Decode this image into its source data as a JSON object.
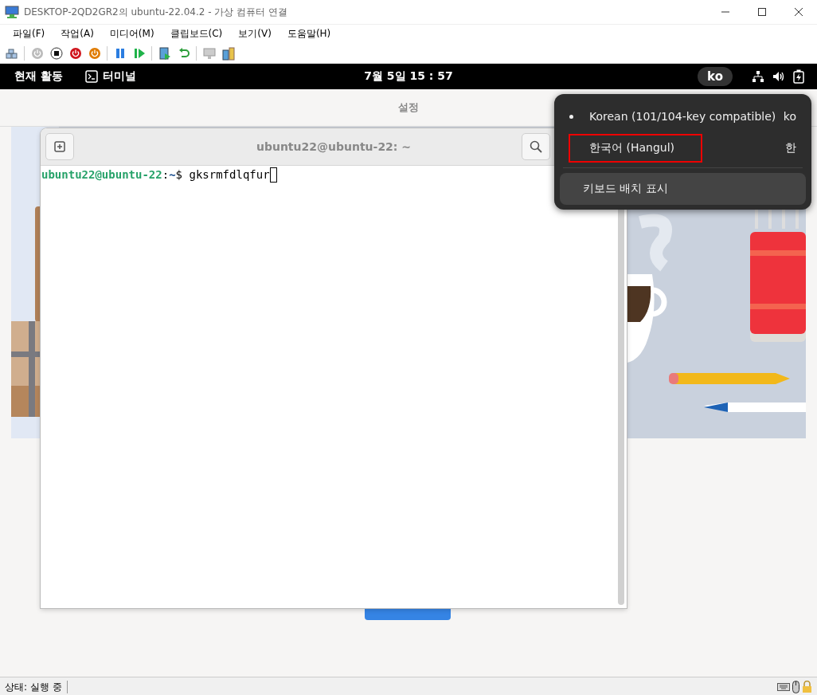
{
  "window": {
    "title": "DESKTOP-2QD2GR2의 ubuntu-22.04.2 - 가상 컴퓨터 연결"
  },
  "menu": [
    "파일(F)",
    "작업(A)",
    "미디어(M)",
    "클립보드(C)",
    "보기(V)",
    "도움말(H)"
  ],
  "guest": {
    "topbar": {
      "activities": "현재 활동",
      "app": "터미널",
      "clock": "7월 5일 15 : 57",
      "input_source": "ko"
    },
    "settings": {
      "title": "설정"
    },
    "terminal": {
      "title": "ubuntu22@ubuntu-22: ~",
      "prompt_user": "ubuntu22@ubuntu-22",
      "prompt_sep": ":",
      "prompt_path": "~",
      "prompt_symbol": "$",
      "command": "gksrmfdlqfur"
    },
    "input_menu": {
      "sources": [
        {
          "label": "Korean (101/104-key compatible)",
          "shortcut": "ko",
          "selected": true,
          "highlighted": false
        },
        {
          "label": "한국어 (Hangul)",
          "shortcut": "한",
          "selected": false,
          "highlighted": true
        }
      ],
      "action": {
        "label": "키보드 배치 표시",
        "hovered": true
      }
    }
  },
  "status_bar": {
    "text": "상태: 실행 중"
  }
}
